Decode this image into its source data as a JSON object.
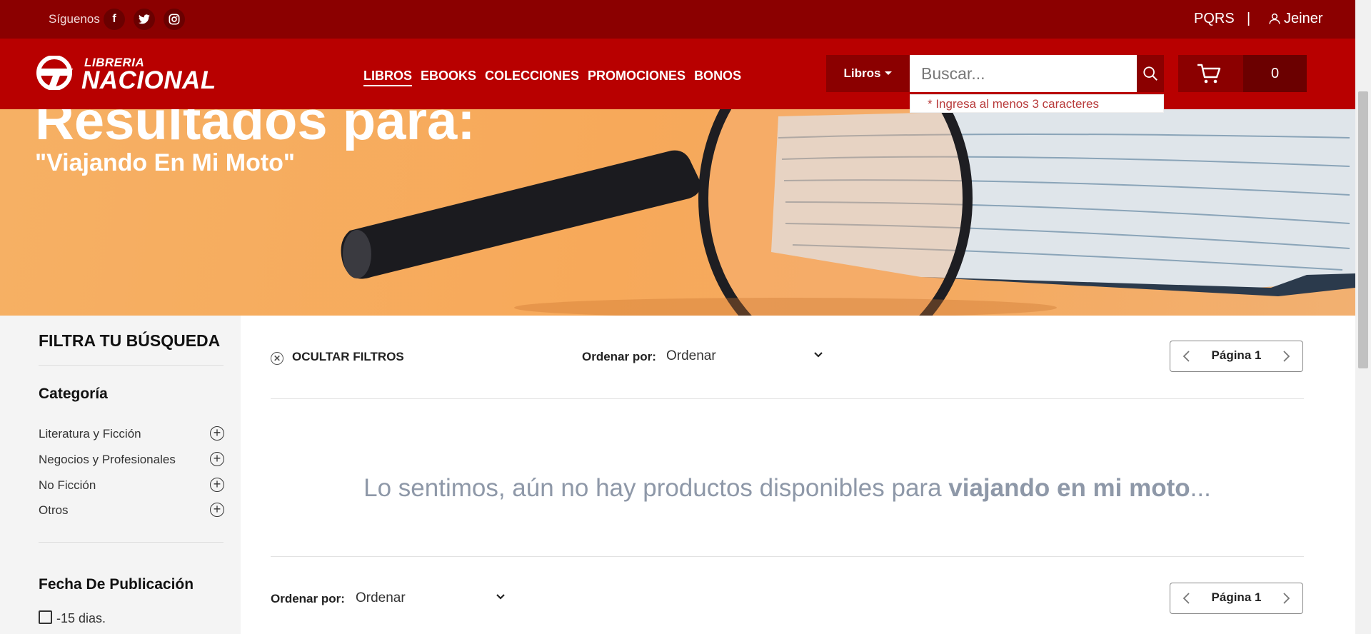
{
  "topbar": {
    "follow_label": "Síguenos",
    "social": [
      "facebook-icon",
      "twitter-icon",
      "instagram-icon"
    ],
    "pqrs": "PQRS",
    "separator": "|",
    "user_name": "Jeiner"
  },
  "header": {
    "logo_line1": "LIBRERIA",
    "logo_line2": "NACIONAL",
    "nav": [
      "LIBROS",
      "EBOOKS",
      "COLECCIONES",
      "PROMOCIONES",
      "BONOS"
    ],
    "category_select": "Libros",
    "search_placeholder": "Buscar...",
    "search_hint": "* Ingresa al menos 3 caracteres",
    "cart_count": "0"
  },
  "banner": {
    "title": "Resultados para:",
    "query": "\"Viajando En Mi Moto\""
  },
  "sidebar": {
    "title": "FILTRA TU BÚSQUEDA",
    "category_heading": "Categoría",
    "categories": [
      "Literatura y Ficción",
      "Negocios y Profesionales",
      "No Ficción",
      "Otros"
    ],
    "date_heading": "Fecha De Publicación",
    "date_option": "-15 dias."
  },
  "content": {
    "hide_filters": "OCULTAR FILTROS",
    "sort_label": "Ordenar por:",
    "sort_value": "Ordenar",
    "page_label": "Página 1",
    "empty_prefix": "Lo sentimos, aún no hay productos disponibles para ",
    "empty_query": "viajando en mi moto",
    "empty_suffix": "..."
  },
  "colors": {
    "topbar": "#8b0000",
    "header": "#b80000",
    "banner": "#f6b064"
  }
}
